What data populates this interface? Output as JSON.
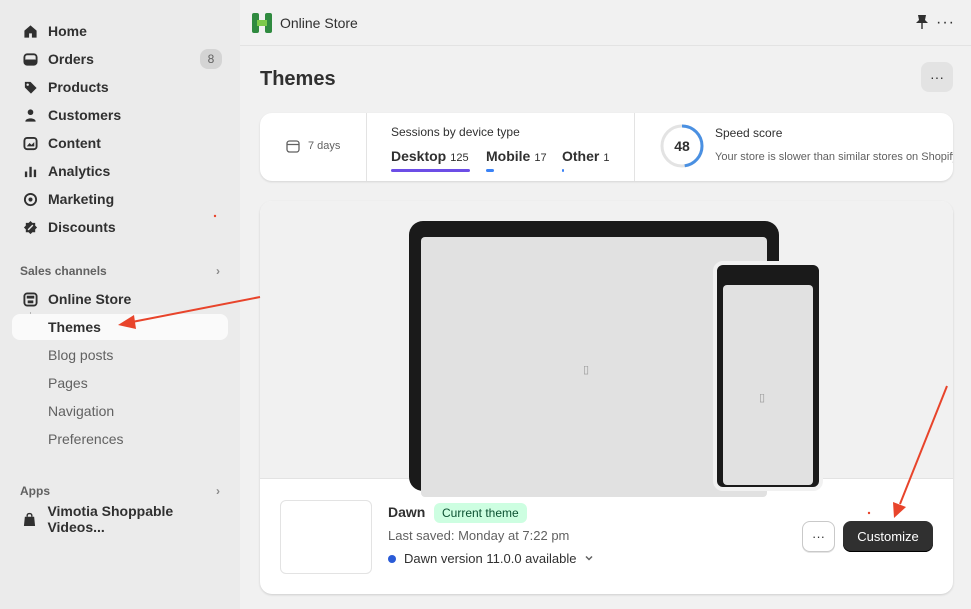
{
  "sidebar": {
    "items": [
      {
        "label": "Home",
        "icon": "home-icon"
      },
      {
        "label": "Orders",
        "icon": "orders-icon",
        "badge": "8"
      },
      {
        "label": "Products",
        "icon": "tag-icon"
      },
      {
        "label": "Customers",
        "icon": "person-icon"
      },
      {
        "label": "Content",
        "icon": "content-icon"
      },
      {
        "label": "Analytics",
        "icon": "chart-icon"
      },
      {
        "label": "Marketing",
        "icon": "target-icon"
      },
      {
        "label": "Discounts",
        "icon": "discount-icon"
      }
    ],
    "sales_channels_title": "Sales channels",
    "online_store_label": "Online Store",
    "sub_items": [
      "Themes",
      "Blog posts",
      "Pages",
      "Navigation",
      "Preferences"
    ],
    "apps_title": "Apps",
    "app_label": "Vimotia Shoppable Videos..."
  },
  "topbar": {
    "store_name": "Online Store"
  },
  "page": {
    "title": "Themes",
    "more_label": "···"
  },
  "metrics": {
    "range_label": "7 days",
    "sessions_title": "Sessions by device type",
    "devices": [
      {
        "name": "Desktop",
        "count": "125",
        "color": "#6c4de6"
      },
      {
        "name": "Mobile",
        "count": "17",
        "color": "#3b82f6"
      },
      {
        "name": "Other",
        "count": "1",
        "color": "#3b82f6"
      }
    ],
    "speed_score": "48",
    "speed_title": "Speed score",
    "speed_desc": "Your store is slower than similar stores on Shopify"
  },
  "theme": {
    "name": "Dawn",
    "badge": "Current theme",
    "saved": "Last saved: Monday at 7:22 pm",
    "version": "Dawn version 11.0.0 available",
    "more_label": "···",
    "customize_label": "Customize"
  },
  "colors": {
    "accent_purple": "#6c4de6",
    "badge_green": "#cdfee1",
    "annotation_red": "#e8442b"
  }
}
